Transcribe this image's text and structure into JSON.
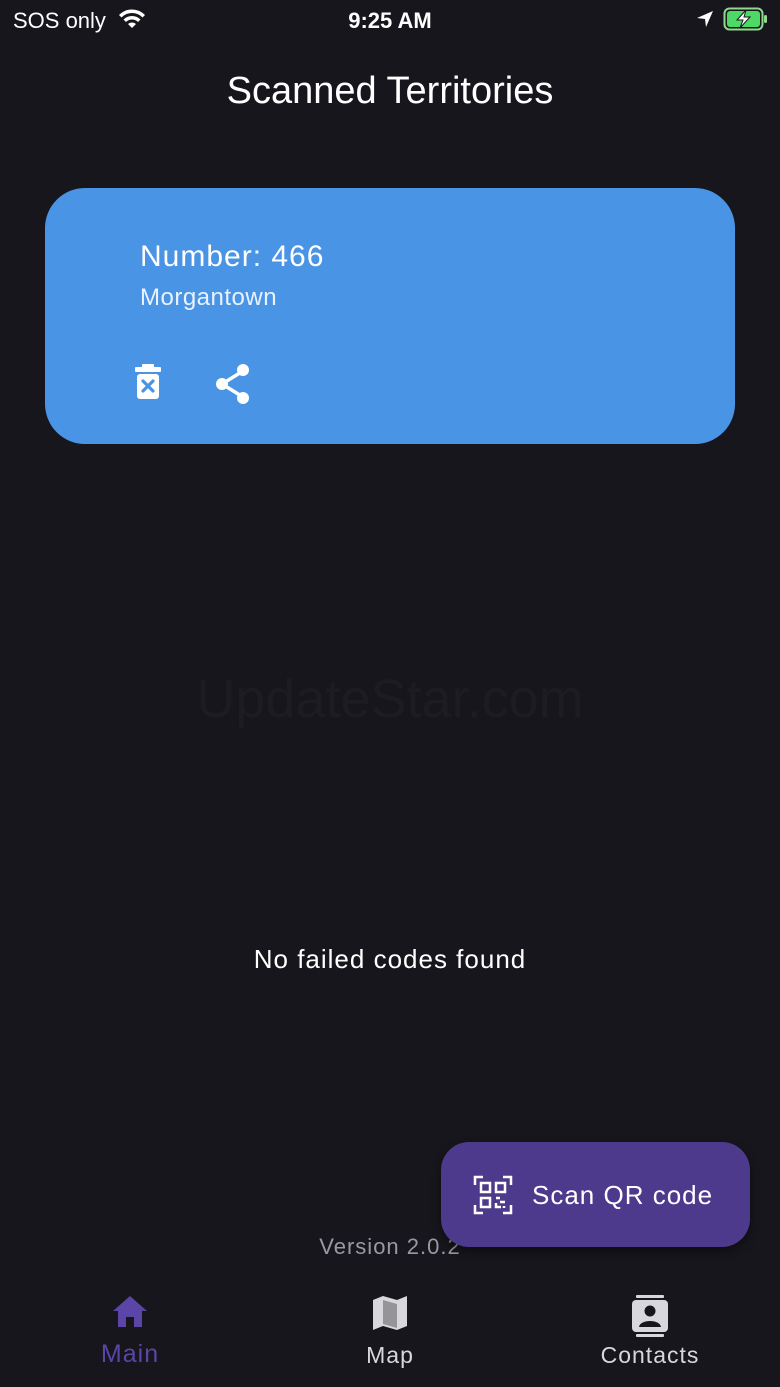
{
  "status_bar": {
    "carrier": "SOS only",
    "time": "9:25 AM",
    "icons": [
      "wifi-icon",
      "location-arrow-icon",
      "battery-charging-icon"
    ]
  },
  "header": {
    "title": "Scanned Territories"
  },
  "territory_card": {
    "number": "Number: 466",
    "city": "Morgantown",
    "actions": [
      "delete-icon",
      "share-icon"
    ],
    "color": "#4a94e6"
  },
  "watermark": "UpdateStar.com",
  "empty_message": "No failed codes found",
  "scan_button": {
    "label": "Scan QR code",
    "icon": "qr-code-icon",
    "color": "#4d3a8c"
  },
  "version": "Version 2.0.2",
  "bottom_nav": {
    "items": [
      {
        "label": "Main",
        "icon": "home-icon",
        "active": true
      },
      {
        "label": "Map",
        "icon": "map-icon",
        "active": false
      },
      {
        "label": "Contacts",
        "icon": "contacts-icon",
        "active": false
      }
    ],
    "active_color": "#5b45a6"
  }
}
